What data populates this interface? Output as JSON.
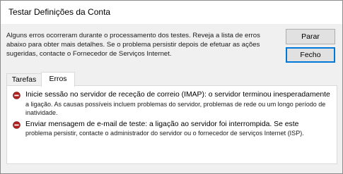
{
  "window": {
    "title": "Testar Definições da Conta"
  },
  "message": "Alguns erros ocorreram durante o processamento dos testes. Reveja a lista de erros abaixo para obter mais detalhes. Se o problema persistir depois de efetuar as ações sugeridas, contacte o Fornecedor de Serviços Internet.",
  "buttons": {
    "stop": "Parar",
    "close": "Fecho"
  },
  "tabs": [
    {
      "label": "Tarefas"
    },
    {
      "label": "Erros"
    }
  ],
  "errors": [
    {
      "icon": "error-icon",
      "heading": "Inicie sessão no servidor de receção de correio (IMAP): o servidor terminou inesperadamente",
      "detail": "a ligação. As causas possíveis incluem problemas do servidor, problemas de rede ou um longo período de inatividade."
    },
    {
      "icon": "error-icon",
      "heading": "Enviar mensagem de e-mail de teste: a ligação ao servidor foi interrompida. Se este",
      "detail": "problema persistir, contacte o administrador do servidor ou o fornecedor de serviços Internet (ISP)."
    }
  ],
  "colors": {
    "error_icon": "#b0201e",
    "accent": "#0078d7"
  }
}
